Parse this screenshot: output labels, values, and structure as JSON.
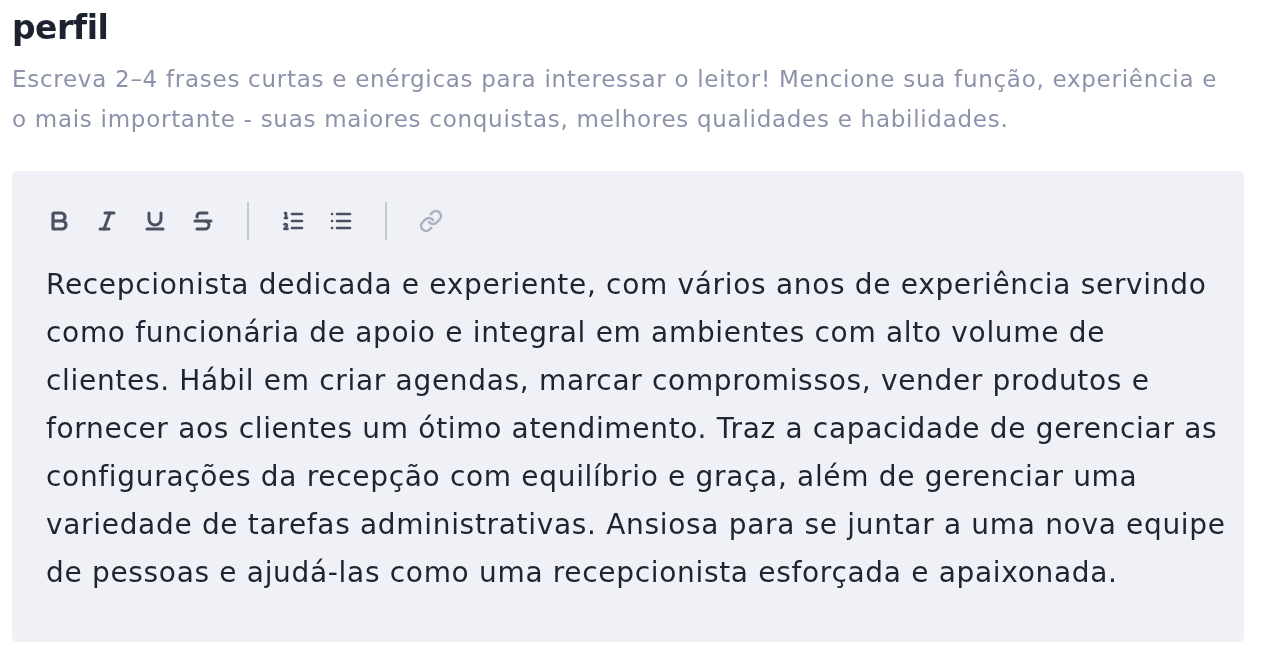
{
  "section": {
    "title": "perfil",
    "hint": "Escreva 2–4 frases curtas e enérgicas para interessar o leitor! Mencione sua função, experiência e o mais importante - suas maiores conquistas, melhores qualidades e habilidades."
  },
  "editor": {
    "toolbar": [
      {
        "tools": [
          {
            "kind": "bold",
            "disabled": false
          },
          {
            "kind": "italic",
            "disabled": false
          },
          {
            "kind": "underline",
            "disabled": false
          },
          {
            "kind": "strikethrough",
            "disabled": false
          }
        ]
      },
      {
        "tools": [
          {
            "kind": "ordered-list",
            "disabled": false
          },
          {
            "kind": "bullet-list",
            "disabled": false
          }
        ]
      },
      {
        "tools": [
          {
            "kind": "link",
            "disabled": true
          }
        ]
      }
    ],
    "text": "Recepcionista dedicada e experiente, com vários anos de experiência servindo como funcionária de apoio e integral em ambientes com alto volume de clientes. Hábil em criar agendas, marcar compromissos, vender produtos e fornecer aos clientes um ótimo atendimento. Traz a capacidade de gerenciar as configurações da recepção com equilíbrio e graça, além de gerenciar uma variedade de tarefas administrativas. Ansiosa para se juntar a uma nova equipe de pessoas e ajudá-las como uma recepcionista esforçada e apaixonada."
  }
}
